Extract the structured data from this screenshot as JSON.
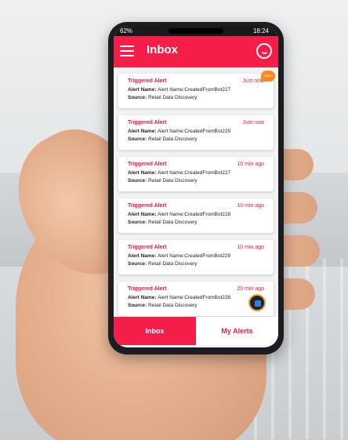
{
  "status_bar": {
    "battery": "62%",
    "time": "18:24"
  },
  "header": {
    "title": "Inbox"
  },
  "alerts": [
    {
      "title": "Triggered Alert",
      "time": "Just now",
      "alert_name_label": "Alert Name:",
      "alert_name": "Alert Name:CreatedFromBot227",
      "source_label": "Source:",
      "source": "Retail Data Discovery",
      "badge": "NEW"
    },
    {
      "title": "Triggered Alert",
      "time": "Just now",
      "alert_name_label": "Alert Name:",
      "alert_name": "Alert Name:CreatedFromBot229",
      "source_label": "Source:",
      "source": "Retail Data Discovery"
    },
    {
      "title": "Triggered Alert",
      "time": "10 min ago",
      "alert_name_label": "Alert Name:",
      "alert_name": "Alert Name:CreatedFromBot227",
      "source_label": "Source:",
      "source": "Retail Data Discovery"
    },
    {
      "title": "Triggered Alert",
      "time": "10 min ago",
      "alert_name_label": "Alert Name:",
      "alert_name": "Alert Name:CreatedFromBot228",
      "source_label": "Source:",
      "source": "Retail Data Discovery"
    },
    {
      "title": "Triggered Alert",
      "time": "10 min ago",
      "alert_name_label": "Alert Name:",
      "alert_name": "Alert Name:CreatedFromBot229",
      "source_label": "Source:",
      "source": "Retail Data Discovery"
    },
    {
      "title": "Triggered Alert",
      "time": "20 min ago",
      "alert_name_label": "Alert Name:",
      "alert_name": "Alert Name:CreatedFromBot228",
      "source_label": "Source:",
      "source": "Retail Data Discovery"
    }
  ],
  "tabs": {
    "inbox": "Inbox",
    "my_alerts": "My Alerts"
  },
  "colors": {
    "accent": "#f51e48",
    "alert_text": "#ec1c3c",
    "badge": "#ff8a1c"
  },
  "icons": {
    "menu": "menu-icon",
    "chat": "chat-icon",
    "fab": "bot-icon"
  }
}
